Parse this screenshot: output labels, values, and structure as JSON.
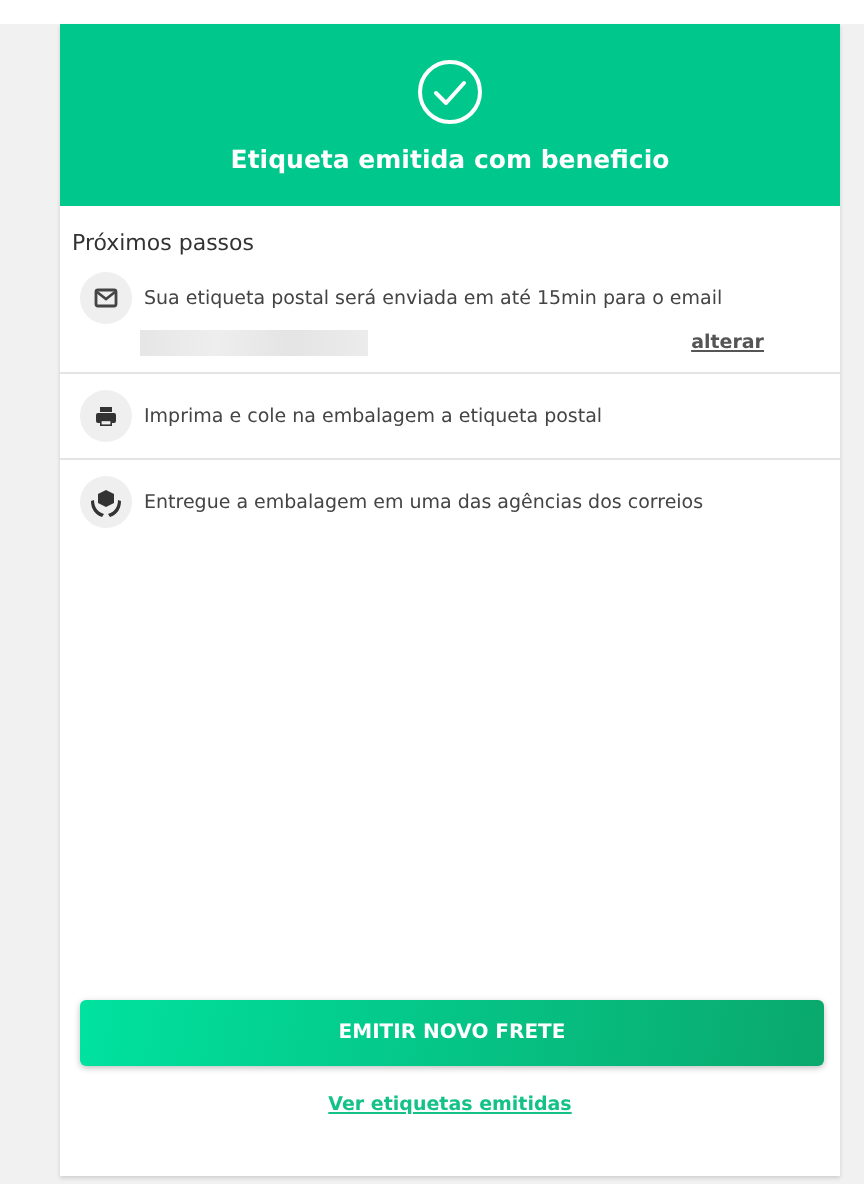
{
  "header": {
    "title": "Etiqueta emitida com beneficio"
  },
  "section_title": "Próximos passos",
  "steps": [
    {
      "kind": "email",
      "text": "Sua etiqueta postal será enviada em até 15min para o email",
      "redacted": true,
      "action": "alterar"
    },
    {
      "kind": "print",
      "text": "Imprima e cole na embalagem a etiqueta postal"
    },
    {
      "kind": "delivery",
      "text": "Entregue a embalagem em uma das agências dos correios"
    }
  ],
  "primary_button": "EMITIR NOVO FRETE",
  "secondary_link": "Ver etiquetas emitidas"
}
